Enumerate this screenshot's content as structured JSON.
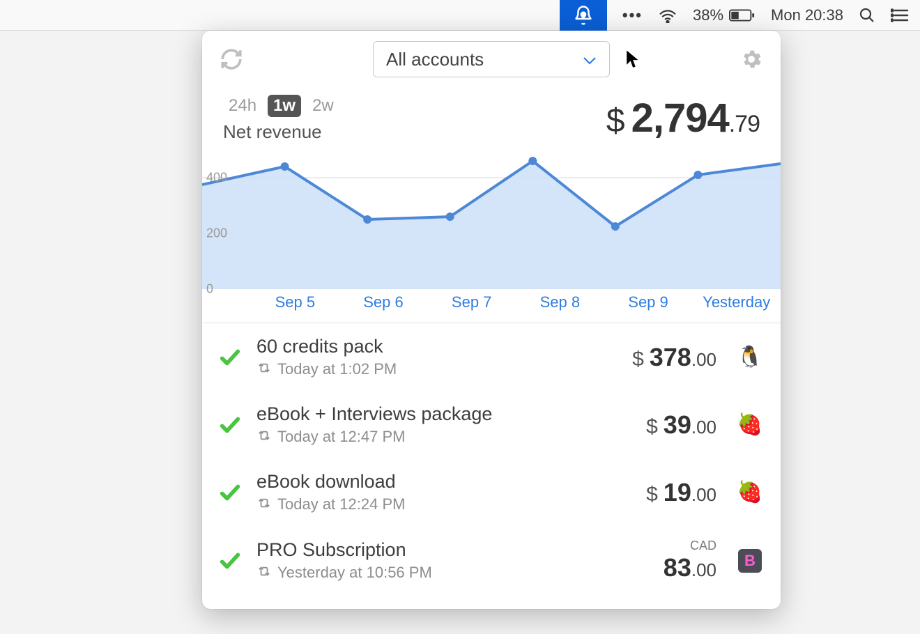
{
  "menubar": {
    "battery_percent": "38%",
    "datetime": "Mon 20:38"
  },
  "header": {
    "account_selector": "All accounts"
  },
  "timerange": {
    "options": [
      "24h",
      "1w",
      "2w"
    ],
    "active_index": 1,
    "metric_label": "Net revenue"
  },
  "revenue": {
    "currency": "$",
    "whole": "2,794",
    "cents": ".79"
  },
  "chart_data": {
    "type": "area",
    "title": "",
    "xlabel": "",
    "ylabel": "",
    "ylim": [
      0,
      500
    ],
    "y_ticks": [
      0,
      200,
      400
    ],
    "categories": [
      "Sep 5",
      "Sep 6",
      "Sep 7",
      "Sep 8",
      "Sep 9",
      "Yesterday"
    ],
    "series": [
      {
        "name": "Net revenue",
        "values": [
          440,
          250,
          260,
          460,
          225,
          410
        ]
      }
    ],
    "leading_edge_value": 375,
    "trailing_edge_value": 450
  },
  "transactions": [
    {
      "title": "60 credits pack",
      "time": "Today at 1:02 PM",
      "currency": "$",
      "whole": "378",
      "cents": ".00",
      "currency_label": "",
      "icon": "penguin",
      "status": "ok"
    },
    {
      "title": "eBook + Interviews package",
      "time": "Today at 12:47 PM",
      "currency": "$",
      "whole": "39",
      "cents": ".00",
      "currency_label": "",
      "icon": "strawberry",
      "status": "ok"
    },
    {
      "title": "eBook download",
      "time": "Today at 12:24 PM",
      "currency": "$",
      "whole": "19",
      "cents": ".00",
      "currency_label": "",
      "icon": "strawberry",
      "status": "ok"
    },
    {
      "title": "PRO Subscription",
      "time": "Yesterday at 10:56 PM",
      "currency": "",
      "whole": "83",
      "cents": ".00",
      "currency_label": "CAD",
      "icon": "badge-b",
      "status": "ok"
    }
  ]
}
